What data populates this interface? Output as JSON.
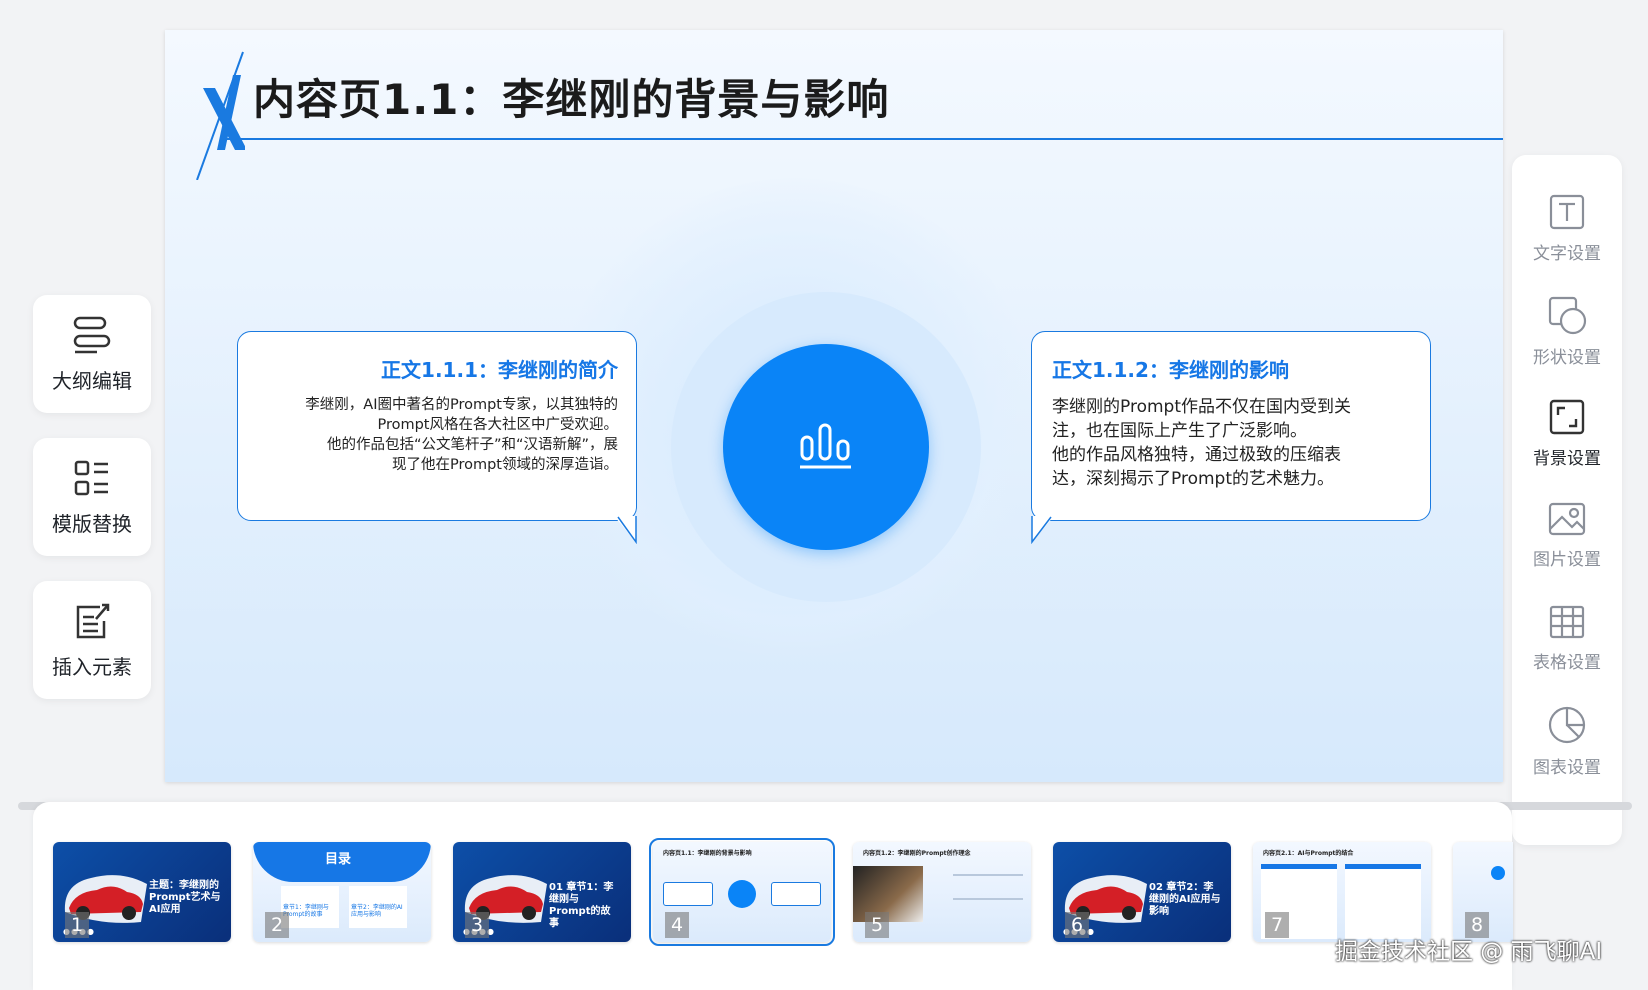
{
  "slide": {
    "title": "内容页1.1：李继刚的背景与影响",
    "left_bubble": {
      "heading": "正文1.1.1：李继刚的简介",
      "lines": [
        "李继刚，AI圈中著名的Prompt专家，以其独特的",
        "Prompt风格在各大社区中广受欢迎。",
        "他的作品包括“公文笔杆子”和“汉语新解”，展",
        "现了他在Prompt领域的深厚造诣。"
      ]
    },
    "right_bubble": {
      "heading": "正文1.1.2：李继刚的影响",
      "lines": [
        "李继刚的Prompt作品不仅在国内受到关",
        "注，也在国际上产生了广泛影响。",
        "他的作品风格独特，通过极致的压缩表",
        "达，深刻揭示了Prompt的艺术魅力。"
      ]
    },
    "center_icon": "bar-chart-icon",
    "accent_color": "#0a84f7"
  },
  "left_tools": [
    {
      "label": "大纲编辑",
      "icon": "outline-icon"
    },
    {
      "label": "模版替换",
      "icon": "template-icon"
    },
    {
      "label": "插入元素",
      "icon": "insert-icon"
    }
  ],
  "right_tools": [
    {
      "label": "文字设置",
      "icon": "text-icon"
    },
    {
      "label": "形状设置",
      "icon": "shape-icon"
    },
    {
      "label": "背景设置",
      "icon": "background-icon"
    },
    {
      "label": "图片设置",
      "icon": "image-icon"
    },
    {
      "label": "表格设置",
      "icon": "table-icon"
    },
    {
      "label": "图表设置",
      "icon": "chart-icon"
    }
  ],
  "thumbnails": [
    {
      "num": "1",
      "text": "主题：李继刚的Prompt艺术与AI应用"
    },
    {
      "num": "2",
      "text": "目录",
      "items": [
        "章节1：李继刚与Prompt的故事",
        "章节2：李继刚的AI应用与影响"
      ]
    },
    {
      "num": "3",
      "text": "01 章节1：李继刚与Prompt的故事"
    },
    {
      "num": "4",
      "text": "内容页1.1：李继刚的背景与影响"
    },
    {
      "num": "5",
      "text": "内容页1.2：李继刚的Prompt创作理念"
    },
    {
      "num": "6",
      "text": "02 章节2：李继刚的AI应用与影响"
    },
    {
      "num": "7",
      "text": "内容页2.1：AI与Prompt的结合"
    },
    {
      "num": "8",
      "text": ""
    }
  ],
  "watermark": "掘金技术社区 @ 雨飞聊AI"
}
